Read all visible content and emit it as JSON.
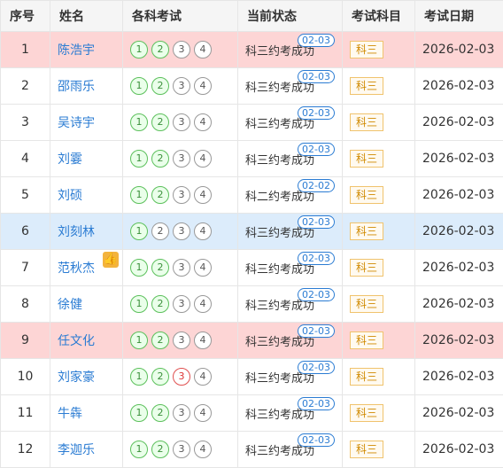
{
  "headers": [
    "序号",
    "姓名",
    "各科考试",
    "当前状态",
    "考试科目",
    "考试日期"
  ],
  "rows": [
    {
      "no": "1",
      "name": "陈浩宇",
      "exams": [
        "1",
        "2",
        "3",
        "4"
      ],
      "status": "科三约考成功",
      "tag": "02-03",
      "subject": "科三",
      "date": "2026-02-03"
    },
    {
      "no": "2",
      "name": "邵雨乐",
      "exams": [
        "1",
        "2",
        "3",
        "4"
      ],
      "status": "科三约考成功",
      "tag": "02-03",
      "subject": "科三",
      "date": "2026-02-03"
    },
    {
      "no": "3",
      "name": "吴诗宇",
      "exams": [
        "1",
        "2",
        "3",
        "4"
      ],
      "status": "科三约考成功",
      "tag": "02-03",
      "subject": "科三",
      "date": "2026-02-03"
    },
    {
      "no": "4",
      "name": "刘霎",
      "exams": [
        "1",
        "2",
        "3",
        "4"
      ],
      "status": "科三约考成功",
      "tag": "02-03",
      "subject": "科三",
      "date": "2026-02-03"
    },
    {
      "no": "5",
      "name": "刘硕",
      "exams": [
        "1",
        "2",
        "3",
        "4"
      ],
      "status": "科二约考成功",
      "tag": "02-02",
      "subject": "科三",
      "date": "2026-02-03"
    },
    {
      "no": "6",
      "name": "刘刻林",
      "exams": [
        "1",
        "2",
        "3",
        "4"
      ],
      "status": "科三约考成功",
      "tag": "02-03",
      "subject": "科三",
      "date": "2026-02-03"
    },
    {
      "no": "7",
      "name": "范秋杰",
      "exams": [
        "1",
        "2",
        "3",
        "4"
      ],
      "status": "科三约考成功",
      "tag": "02-03",
      "subject": "科三",
      "date": "2026-02-03"
    },
    {
      "no": "8",
      "name": "徐健",
      "exams": [
        "1",
        "2",
        "3",
        "4"
      ],
      "status": "科三约考成功",
      "tag": "02-03",
      "subject": "科三",
      "date": "2026-02-03"
    },
    {
      "no": "9",
      "name": "任文化",
      "exams": [
        "1",
        "2",
        "3",
        "4"
      ],
      "status": "科三约考成功",
      "tag": "02-03",
      "subject": "科三",
      "date": "2026-02-03"
    },
    {
      "no": "10",
      "name": "刘家豪",
      "exams": [
        "1",
        "2",
        "3",
        "4"
      ],
      "status": "科三约考成功",
      "tag": "02-03",
      "subject": "科三",
      "date": "2026-02-03"
    },
    {
      "no": "11",
      "name": "牛犇",
      "exams": [
        "1",
        "2",
        "3",
        "4"
      ],
      "status": "科三约考成功",
      "tag": "02-03",
      "subject": "科三",
      "date": "2026-02-03"
    },
    {
      "no": "12",
      "name": "李迦乐",
      "exams": [
        "1",
        "2",
        "3",
        "4"
      ],
      "status": "科三约考成功",
      "tag": "02-03",
      "subject": "科三",
      "date": "2026-02-03"
    }
  ]
}
